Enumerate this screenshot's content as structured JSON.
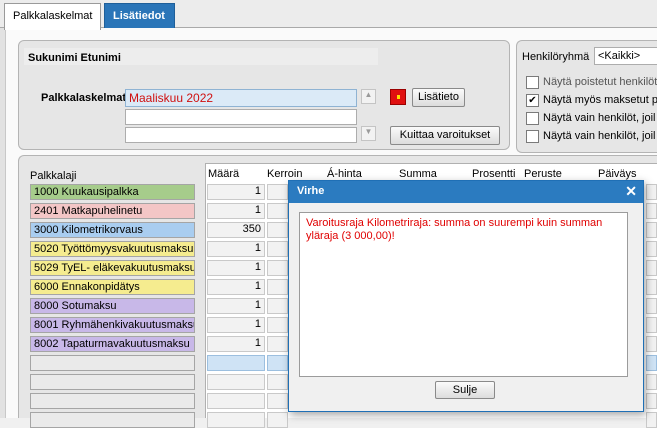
{
  "tabs": [
    {
      "label": "Palkkalaskelmat"
    },
    {
      "label": "Lisätiedot"
    }
  ],
  "employee": {
    "name": "Sukunimi Etunimi",
    "palkkalaskelmat_label": "Palkkalaskelmat",
    "selected_slip": "Maaliskuu 2022",
    "lisatieto_button": "Lisätieto",
    "kuittaa_button": "Kuittaa varoitukset",
    "warning_color": "#e01010"
  },
  "filters": {
    "henkiloryhma_label": "Henkilöryhmä",
    "henkiloryhma_value": "<Kaikki>",
    "options": [
      {
        "label": "Näytä poistetut henkilöt",
        "checked": false
      },
      {
        "label": "Näytä myös maksetut p",
        "checked": true
      },
      {
        "label": "Näytä vain henkilöt, joil",
        "checked": false
      },
      {
        "label": "Näytä vain henkilöt, joil",
        "checked": false
      }
    ]
  },
  "grid": {
    "palkkalaji_header": "Palkkalaji",
    "columns": [
      "Määrä",
      "Kerroin",
      "Á-hinta",
      "Summa",
      "Prosentti",
      "Peruste",
      "Päiväys"
    ],
    "rows": [
      {
        "label": "1000 Kuukausipalkka",
        "color": "#a6cc8b",
        "maara": "1"
      },
      {
        "label": "2401 Matkapuhelinetu",
        "color": "#f3c6c6",
        "maara": "1"
      },
      {
        "label": "3000 Kilometrikorvaus",
        "color": "#a9cdf0",
        "maara": "350"
      },
      {
        "label": "5020 Työttömyysvakuutusmaksu",
        "color": "#f5ec8f",
        "maara": "1"
      },
      {
        "label": "5029 TyEL- eläkevakuutusmaksu",
        "color": "#f5ec8f",
        "maara": "1"
      },
      {
        "label": "6000 Ennakonpidätys",
        "color": "#f5ec8f",
        "maara": "1"
      },
      {
        "label": "8000 Sotumaksu",
        "color": "#c8b8e8",
        "maara": "1"
      },
      {
        "label": "8001 Ryhmähenkivakuutusmaksu",
        "color": "#c8b8e8",
        "maara": "1"
      },
      {
        "label": "8002 Tapaturmavakuutusmaksu",
        "color": "#c8b8e8",
        "maara": "1"
      }
    ]
  },
  "dialog": {
    "title": "Virhe",
    "message": "Varoitusraja Kilometriraja: summa on suurempi kuin summan yläraja (3 000,00)!",
    "button": "Sulje"
  }
}
